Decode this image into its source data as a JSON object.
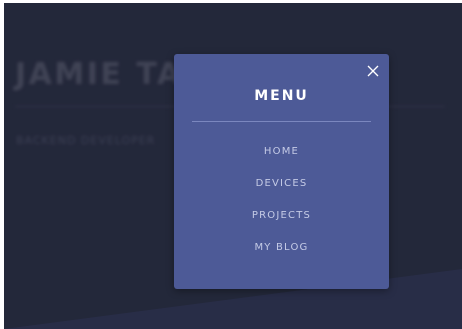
{
  "background": {
    "name": "JAMIE TAN",
    "role": "BACKEND DEVELOPER"
  },
  "menu": {
    "title": "MENU",
    "close_icon": "close-icon",
    "items": [
      {
        "label": "HOME"
      },
      {
        "label": "DEVICES"
      },
      {
        "label": "PROJECTS"
      },
      {
        "label": "MY BLOG"
      }
    ]
  },
  "colors": {
    "page_background": "#272c40",
    "modal_background": "#4d5a97",
    "menu_item_text": "#c5cbe6",
    "title_text": "#ffffff"
  }
}
